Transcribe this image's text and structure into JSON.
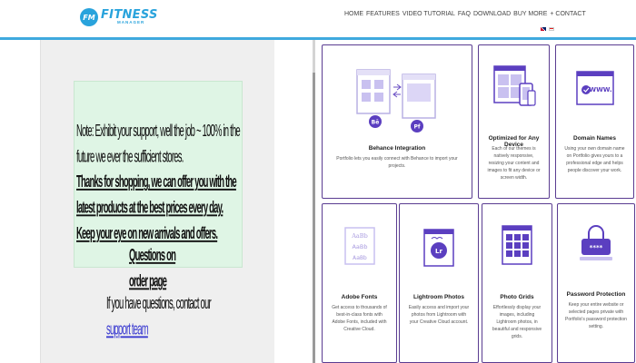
{
  "header": {
    "logo_badge": "FM",
    "logo_main": "FITNESS",
    "logo_sub": "MANAGER",
    "nav": [
      "HOME",
      "FEATURES",
      "VIDEO TUTORIAL",
      "FAQ",
      "DOWNLOAD",
      "BUY MORE",
      "+ CONTACT"
    ],
    "languages": [
      "English",
      "Bahasa Indonesia"
    ]
  },
  "preview": {
    "p1": "Note: Exhibit your support, well the job ~ 100% in the future we ever the sufficient stores.",
    "p2": "Thanks for shopping, we can offer you with the latest products at the best prices every day. Keep your eye on new arrivals and offers.",
    "p3": "Questions on order page",
    "p4_prefix": "If you have questions, contact our",
    "p4_link": "support team"
  },
  "features": [
    {
      "title": "Behance Integration",
      "desc": "Portfolio lets you easily connect with Behance to import your projects.",
      "icon": "behance-integration-icon"
    },
    {
      "title": "Optimized for Any Device",
      "desc": "Each of our themes is natively responsive, resizing your content and images to fit any device or screen width.",
      "icon": "devices-icon"
    },
    {
      "title": "Domain Names",
      "desc": "Using your own domain name on Portfolio gives yours to a professional edge and helps people discover your work.",
      "icon": "domain-icon",
      "icon_text": "WWW."
    },
    {
      "title": "Adobe Fonts",
      "desc": "Get access to thousands of best-in-class fonts with Adobe Fonts, included with Creative Cloud.",
      "icon": "fonts-icon",
      "icon_text": [
        "AaBb",
        "AaBb",
        "AaBb"
      ]
    },
    {
      "title": "Lightroom Photos",
      "desc": "Easily access and import your photos from Lightroom with your Creative Cloud account.",
      "icon": "lightroom-icon",
      "icon_text": "Lr"
    },
    {
      "title": "Photo Grids",
      "desc": "Effortlessly display your images, including Lightroom photos, in beautiful and responsive grids.",
      "icon": "grid-icon"
    },
    {
      "title": "Password Protection",
      "desc": "Keep your entire website or selected pages private with Portfolio's password protection setting.",
      "icon": "lock-icon",
      "icon_text": "****"
    }
  ],
  "colors": {
    "accent": "#3fa9de",
    "card_border": "#5a3c91",
    "icon_purple": "#6a4fc4",
    "green_box": "#dff5e5"
  }
}
